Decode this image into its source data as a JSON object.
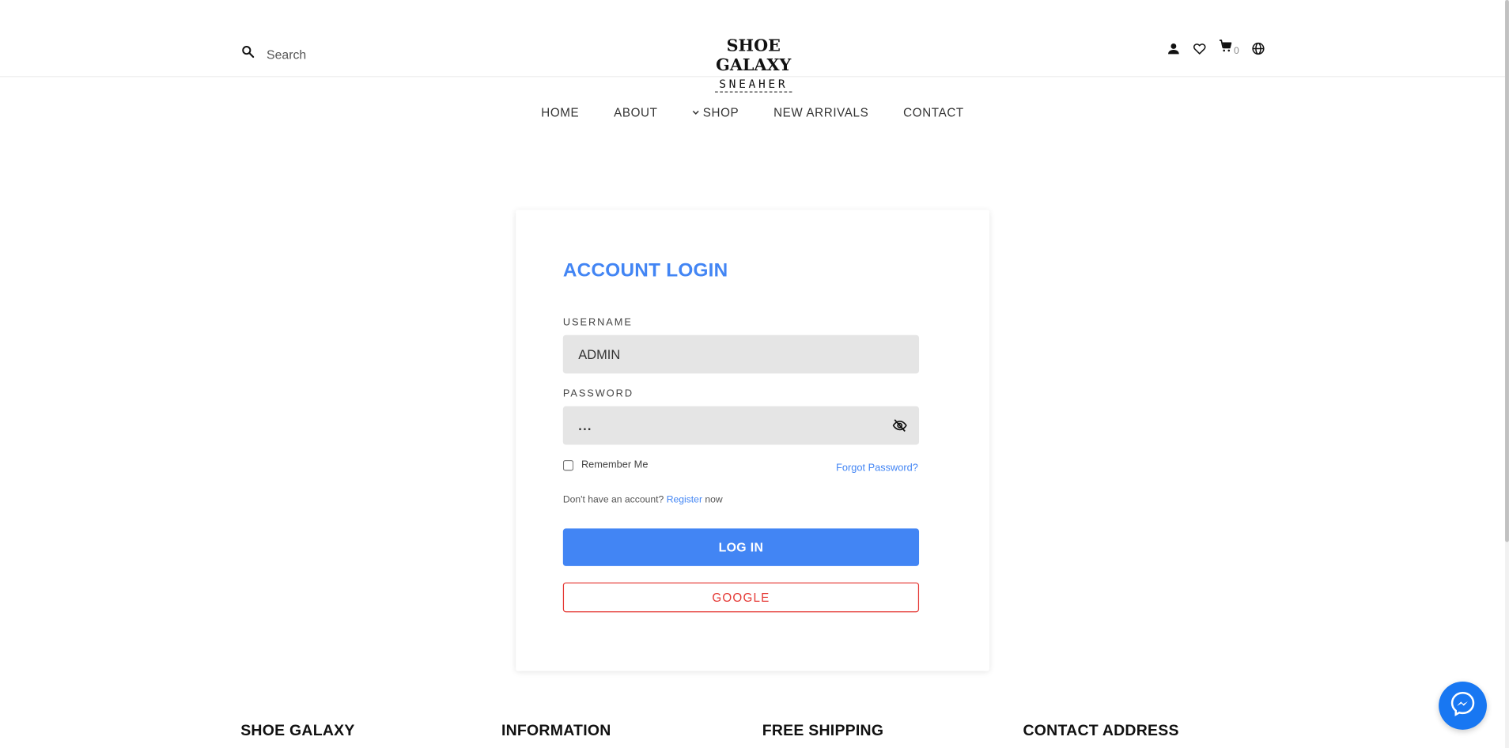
{
  "header": {
    "search_placeholder": "Search",
    "logo_top": "SHOE GALAXY",
    "logo_bottom": "SNEAHER",
    "cart_count": "0",
    "icons": [
      "user-icon",
      "heart-icon",
      "cart-icon",
      "globe-icon"
    ]
  },
  "nav": {
    "items": [
      {
        "label": "HOME"
      },
      {
        "label": "ABOUT"
      },
      {
        "label": "SHOP",
        "has_dropdown": true
      },
      {
        "label": "NEW ARRIVALS"
      },
      {
        "label": "CONTACT"
      }
    ]
  },
  "login": {
    "title": "ACCOUNT LOGIN",
    "username_label": "USERNAME",
    "username_value": "ADMIN",
    "password_label": "PASSWORD",
    "password_value": "...",
    "remember_label": "Remember Me",
    "remember_checked": false,
    "forgot_label": "Forgot Password?",
    "no_account_text": "Don't have an account?",
    "register_label": "Register",
    "register_suffix": "now",
    "login_button": "LOG IN",
    "google_button": "GOOGLE"
  },
  "footer": {
    "headings": [
      "SHOE GALAXY",
      "INFORMATION",
      "FREE SHIPPING",
      "CONTACT ADDRESS"
    ]
  },
  "colors": {
    "accent": "#4285f4",
    "google": "#e53935",
    "field_bg": "#e5e5e5",
    "messenger": "#1877f2"
  }
}
